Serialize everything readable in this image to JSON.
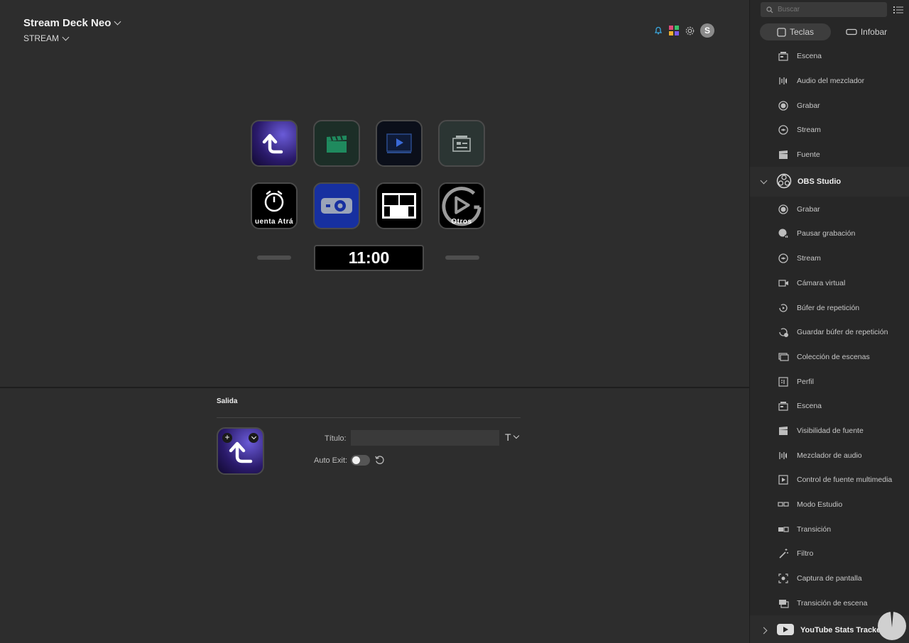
{
  "header": {
    "device_name": "Stream Deck Neo",
    "profile": "STREAM",
    "avatar_letter": "S"
  },
  "keys": {
    "k6_label": "uenta Atrá",
    "k8_label": "Otros"
  },
  "clock": {
    "time": "11:00"
  },
  "inspector": {
    "section_title": "Salida",
    "title_label": "Título:",
    "title_value": "",
    "text_format_glyph": "T",
    "auto_exit_label": "Auto Exit:",
    "auto_exit_on": false
  },
  "sidebar": {
    "search_placeholder": "Buscar",
    "tab_keys": "Teclas",
    "tab_infobar": "Infobar",
    "items_top": [
      {
        "label": "Escena",
        "icon": "scene-icon"
      },
      {
        "label": "Audio del mezclador",
        "icon": "mixer-audio-icon"
      },
      {
        "label": "Grabar",
        "icon": "record-icon"
      },
      {
        "label": "Stream",
        "icon": "stream-icon"
      },
      {
        "label": "Fuente",
        "icon": "source-icon"
      }
    ],
    "group_obs": "OBS Studio",
    "items_obs": [
      {
        "label": "Grabar",
        "icon": "record-icon"
      },
      {
        "label": "Pausar grabación",
        "icon": "pause-record-icon"
      },
      {
        "label": "Stream",
        "icon": "stream-icon"
      },
      {
        "label": "Cámara virtual",
        "icon": "virtual-camera-icon"
      },
      {
        "label": "Búfer de repetición",
        "icon": "replay-buffer-icon"
      },
      {
        "label": "Guardar búfer de repetición",
        "icon": "save-replay-icon"
      },
      {
        "label": "Colección de escenas",
        "icon": "scene-collection-icon"
      },
      {
        "label": "Perfil",
        "icon": "profile-icon"
      },
      {
        "label": "Escena",
        "icon": "scene-icon"
      },
      {
        "label": "Visibilidad de fuente",
        "icon": "source-visibility-icon"
      },
      {
        "label": "Mezclador de audio",
        "icon": "audio-mixer-icon"
      },
      {
        "label": "Control de fuente multimedia",
        "icon": "media-source-icon"
      },
      {
        "label": "Modo Estudio",
        "icon": "studio-mode-icon"
      },
      {
        "label": "Transición",
        "icon": "transition-icon"
      },
      {
        "label": "Filtro",
        "icon": "filter-icon"
      },
      {
        "label": "Captura de pantalla",
        "icon": "screenshot-icon"
      },
      {
        "label": "Transición de escena",
        "icon": "scene-transition-icon"
      }
    ],
    "group_youtube": "YouTube Stats Tracker"
  },
  "colors": {
    "background": "#2d2d2d",
    "sidebar": "#272727",
    "key_purple": "#3b2a8f",
    "key_blue": "#1a3aa0",
    "clapper_green": "#1f8a5e"
  }
}
